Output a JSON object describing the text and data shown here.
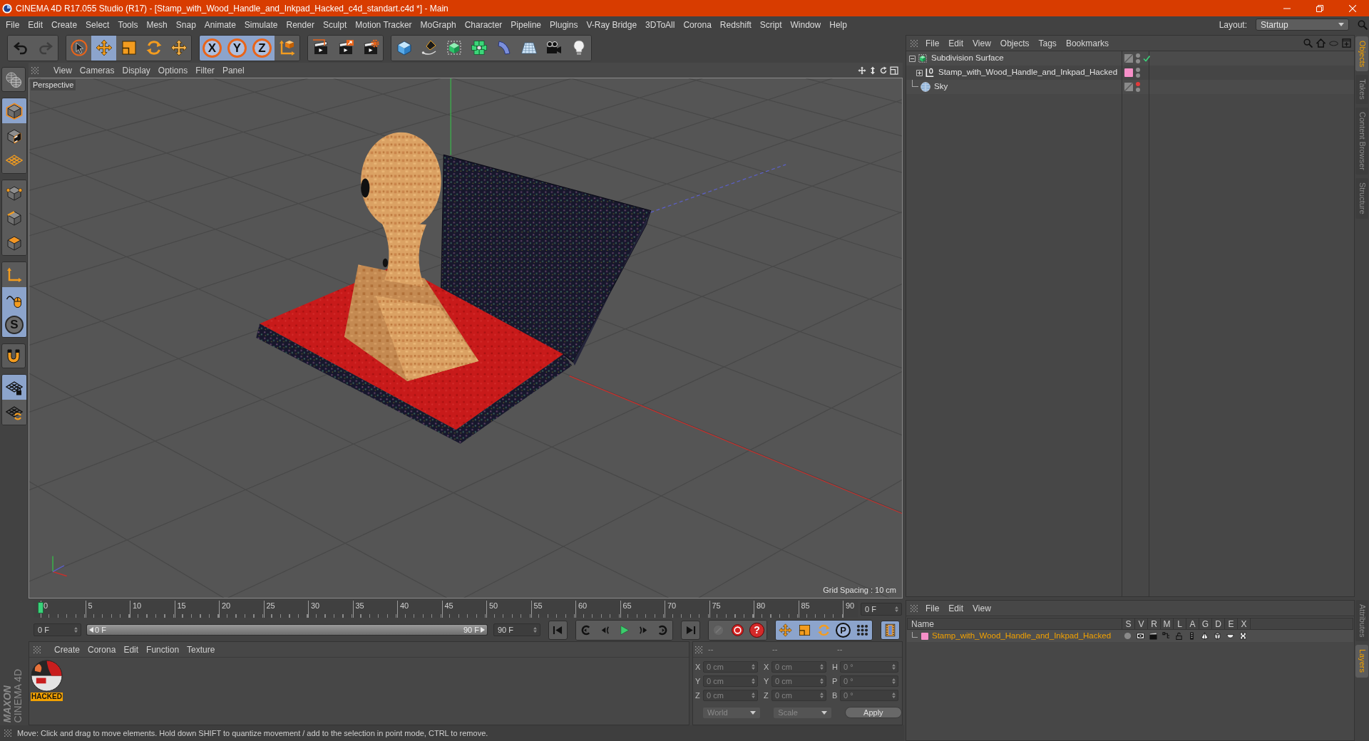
{
  "window": {
    "title": "CINEMA 4D R17.055 Studio (R17) - [Stamp_with_Wood_Handle_and_Inkpad_Hacked_c4d_standart.c4d *] - Main"
  },
  "menu": [
    "File",
    "Edit",
    "Create",
    "Select",
    "Tools",
    "Mesh",
    "Snap",
    "Animate",
    "Simulate",
    "Render",
    "Sculpt",
    "Motion Tracker",
    "MoGraph",
    "Character",
    "Pipeline",
    "Plugins",
    "V-Ray Bridge",
    "3DToAll",
    "Corona",
    "Redshift",
    "Script",
    "Window",
    "Help"
  ],
  "layout": {
    "label": "Layout:",
    "value": "Startup"
  },
  "toolbar": [
    [
      {
        "kind": "undo"
      },
      {
        "kind": "redo",
        "disabled": true
      }
    ],
    [
      {
        "kind": "select",
        "selected": false
      },
      {
        "kind": "move",
        "selected": true
      },
      {
        "kind": "scale",
        "selected": false
      },
      {
        "kind": "rotate",
        "selected": false
      },
      {
        "kind": "transform",
        "selected": false
      }
    ],
    [
      {
        "kind": "axis",
        "label": "X",
        "selected": true
      },
      {
        "kind": "axis",
        "label": "Y",
        "selected": true
      },
      {
        "kind": "axis",
        "label": "Z",
        "selected": true
      },
      {
        "kind": "coords",
        "selected": false
      }
    ],
    [
      {
        "kind": "renderview"
      },
      {
        "kind": "render"
      },
      {
        "kind": "rendersettings"
      }
    ],
    [
      {
        "kind": "cube"
      },
      {
        "kind": "pen"
      },
      {
        "kind": "subdivision"
      },
      {
        "kind": "cloner"
      },
      {
        "kind": "bend"
      },
      {
        "kind": "floor"
      },
      {
        "kind": "camera"
      },
      {
        "kind": "light"
      }
    ]
  ],
  "left_toolbar": [
    [
      {
        "kind": "globe"
      }
    ],
    [
      {
        "kind": "model",
        "selected": true
      },
      {
        "kind": "texture",
        "selected": false
      },
      {
        "kind": "workplane",
        "selected": false
      }
    ],
    [
      {
        "kind": "points",
        "selected": false
      },
      {
        "kind": "edges",
        "selected": false
      },
      {
        "kind": "polygons",
        "selected": false
      }
    ],
    [
      {
        "kind": "axis3d",
        "selected": false
      },
      {
        "kind": "tweak",
        "selected": true
      },
      {
        "kind": "snap",
        "label": "S",
        "selected": true
      }
    ],
    [
      {
        "kind": "magnet",
        "selected": false
      }
    ],
    [
      {
        "kind": "gridlock",
        "selected": true
      },
      {
        "kind": "gridrotate",
        "selected": false
      }
    ]
  ],
  "brand": [
    "MAXON",
    "CINEMA 4D"
  ],
  "viewport": {
    "menu": [
      "View",
      "Cameras",
      "Display",
      "Options",
      "Filter",
      "Panel"
    ],
    "camera": "Perspective",
    "grid_spacing": "Grid Spacing : 10 cm"
  },
  "timeline": {
    "ticks": [
      "0",
      "5",
      "10",
      "15",
      "20",
      "25",
      "30",
      "35",
      "40",
      "45",
      "50",
      "55",
      "60",
      "65",
      "70",
      "75",
      "80",
      "85",
      "90"
    ],
    "level": 0,
    "current_frame": "0 F",
    "start": "0 F",
    "range": {
      "start": "0 F",
      "end": "90 F",
      "level": 1
    },
    "end": "90 F"
  },
  "transport": [
    [
      {
        "kind": "start"
      }
    ],
    [
      {
        "kind": "prevkey"
      },
      {
        "kind": "prevframe"
      },
      {
        "kind": "play"
      },
      {
        "kind": "nextframe"
      },
      {
        "kind": "nextkey"
      }
    ],
    [
      {
        "kind": "end"
      }
    ],
    [
      {
        "kind": "keylock",
        "disabled": true
      },
      {
        "kind": "record"
      },
      {
        "kind": "autokey",
        "label": "?"
      }
    ],
    [
      {
        "kind": "move",
        "selected": true
      },
      {
        "kind": "scale",
        "selected": true
      },
      {
        "kind": "rotate",
        "selected": true
      },
      {
        "kind": "param",
        "label": "P",
        "selected": true
      },
      {
        "kind": "pla",
        "selected": true
      }
    ],
    [
      {
        "kind": "film",
        "selected": true
      }
    ]
  ],
  "materials": {
    "menu": [
      "Create",
      "Corona",
      "Edit",
      "Function",
      "Texture"
    ],
    "items": [
      {
        "name": "HACKED",
        "selected": true
      }
    ]
  },
  "coordinates": {
    "headers": [
      "--",
      "--",
      "--"
    ],
    "rows": [
      [
        {
          "axis": "X",
          "value": "0 cm"
        },
        {
          "axis": "X",
          "value": "0 cm"
        },
        {
          "axis": "H",
          "value": "0 °"
        }
      ],
      [
        {
          "axis": "Y",
          "value": "0 cm"
        },
        {
          "axis": "Y",
          "value": "0 cm"
        },
        {
          "axis": "P",
          "value": "0 °"
        }
      ],
      [
        {
          "axis": "Z",
          "value": "0 cm"
        },
        {
          "axis": "Z",
          "value": "0 cm"
        },
        {
          "axis": "B",
          "value": "0 °"
        }
      ]
    ],
    "space": "World",
    "mode": "Scale",
    "apply": "Apply"
  },
  "status_bar": "Move: Click and drag to move elements. Hold down SHIFT to quantize movement / add to the selection in point mode, CTRL to remove.",
  "objects": {
    "menu": [
      "File",
      "Edit",
      "View",
      "Objects",
      "Tags",
      "Bookmarks"
    ],
    "tree": [
      {
        "kind": "subdivision",
        "name": "Subdivision Surface",
        "expanded": true,
        "enabled": true,
        "editor_visible": true,
        "children": [
          {
            "kind": "null",
            "name": "Stamp_with_Wood_Handle_and_Inkpad_Hacked",
            "expanded": false,
            "color": "#f68fc8",
            "editor_visible": true
          }
        ]
      },
      {
        "kind": "sky",
        "name": "Sky",
        "editor_visible": false
      }
    ]
  },
  "layers": {
    "menu": [
      "File",
      "Edit",
      "View"
    ],
    "columns": [
      "Name",
      "S",
      "V",
      "R",
      "M",
      "L",
      "A",
      "G",
      "D",
      "E",
      "X"
    ],
    "rows": [
      {
        "name": "Stamp_with_Wood_Handle_and_Inkpad_Hacked",
        "color": "#f68fc8"
      }
    ]
  },
  "side_tabs": {
    "top": [
      {
        "label": "Objects",
        "selected": true
      },
      {
        "label": "Takes",
        "selected": false
      },
      {
        "label": "Content Browser",
        "selected": false
      },
      {
        "label": "Structure",
        "selected": false
      }
    ],
    "bottom": [
      {
        "label": "Attributes",
        "selected": false
      },
      {
        "label": "Layers",
        "selected": true
      }
    ]
  }
}
